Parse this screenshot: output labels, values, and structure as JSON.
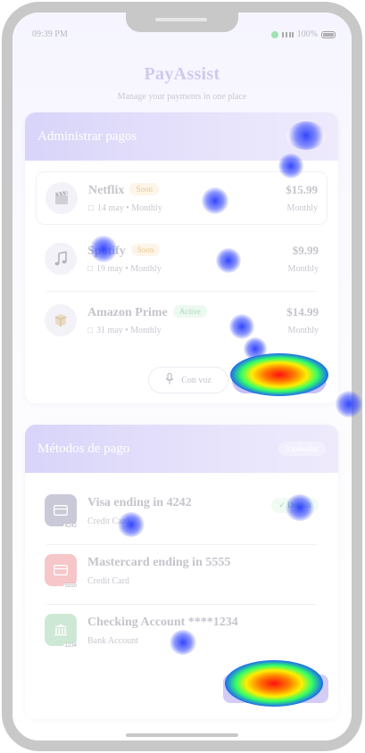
{
  "status_bar": {
    "time": "09:39 PM",
    "battery": "100%"
  },
  "header": {
    "title": "PayAssist",
    "subtitle": "Manage your payments in one place"
  },
  "payments": {
    "title": "Administrar pagos",
    "badge": "3 pagos",
    "items": [
      {
        "icon": "clapperboard-icon",
        "name": "Netflix",
        "status": "Soon",
        "date": "14 may • Monthly",
        "price": "$15.99",
        "period": "Monthly"
      },
      {
        "icon": "music-note-icon",
        "name": "Spotify",
        "status": "Soon",
        "date": "19 may • Monthly",
        "price": "$9.99",
        "period": "Monthly"
      },
      {
        "icon": "package-icon",
        "name": "Amazon Prime",
        "status": "Active",
        "date": "31 may • Monthly",
        "price": "$14.99",
        "period": "Monthly"
      }
    ],
    "voice_button": "Con voz",
    "add_button": "Agregar pago"
  },
  "methods": {
    "title": "Métodos de pago",
    "badge": "3 métodos",
    "items": [
      {
        "icon": "credit-card-icon",
        "digits": "4242",
        "name": "Visa ending in 4242",
        "type": "Credit Card",
        "default_label": "Default",
        "color": "#c9c9d8"
      },
      {
        "icon": "credit-card-icon",
        "digits": "5555",
        "name": "Mastercard ending in 5555",
        "type": "Credit Card",
        "color": "#f6c6c9"
      },
      {
        "icon": "bank-icon",
        "digits": "1234",
        "name": "Checking Account ****1234",
        "type": "Bank Account",
        "color": "#cde8d4"
      }
    ],
    "add_button": "Agregar método"
  },
  "colors": {
    "accent": "#c7c0f6",
    "header_gradient_start": "#d8d4fa",
    "active_tag": "#a9dbb9",
    "soon_tag": "#e4c896"
  }
}
